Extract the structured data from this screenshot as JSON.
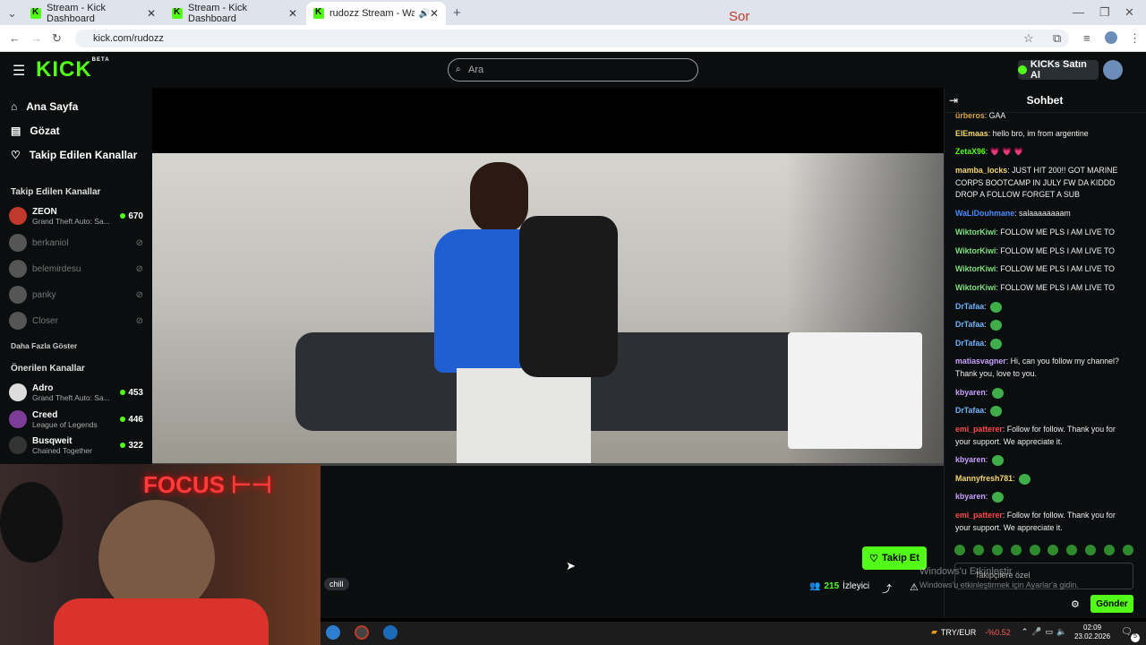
{
  "browser": {
    "tabs": [
      {
        "title": "Stream - Kick Dashboard"
      },
      {
        "title": "Stream - Kick Dashboard"
      },
      {
        "title": "rudozz Stream - Watch Live"
      }
    ],
    "url": "kick.com/rudozz",
    "overlay_text": "Sor"
  },
  "header": {
    "logo": "KICK",
    "logo_badge": "BETA",
    "search_placeholder": "Ara",
    "kicks_button": "KICKs Satın Al"
  },
  "sidebar": {
    "nav": [
      {
        "label": "Ana Sayfa",
        "icon": "home-icon"
      },
      {
        "label": "Gözat",
        "icon": "browse-icon"
      },
      {
        "label": "Takip Edilen Kanallar",
        "icon": "heart-icon"
      }
    ],
    "followed_title": "Takip Edilen Kanallar",
    "followed": [
      {
        "name": "ZEON",
        "game": "Grand Theft Auto: Sa...",
        "viewers": "670",
        "live": true
      },
      {
        "name": "berkaniol",
        "live": false
      },
      {
        "name": "belemirdesu",
        "live": false
      },
      {
        "name": "panky",
        "live": false
      },
      {
        "name": "Closer",
        "live": false
      }
    ],
    "show_more": "Daha Fazla Göster",
    "recommended_title": "Önerilen Kanallar",
    "recommended": [
      {
        "name": "Adro",
        "game": "Grand Theft Auto: Sa...",
        "viewers": "453"
      },
      {
        "name": "Creed",
        "game": "League of Legends",
        "viewers": "446"
      },
      {
        "name": "Busqweit",
        "game": "Chained Together",
        "viewers": "322"
      }
    ]
  },
  "player": {
    "follow_button": "Takip Et",
    "tag": "chill",
    "viewer_count": "215",
    "viewer_label": "İzleyici"
  },
  "chat": {
    "title": "Sohbet",
    "messages": [
      {
        "user": "ürberos",
        "color": "#d7a64a",
        "text": "GAA"
      },
      {
        "user": "ElEmaas",
        "color": "#f5d76e",
        "text": "hello bro, im from argentine"
      },
      {
        "user": "ZetaX96",
        "color": "#53fc18",
        "text": "💗 💗 💗"
      },
      {
        "user": "mamba_locks",
        "color": "#f5d76e",
        "text": "JUST HIT 200!! GOT MARINE CORPS BOOTCAMP IN JULY FW DA KIDDD DROP A FOLLOW FORGET A SUB"
      },
      {
        "user": "WaLiDouhmane",
        "color": "#4a8cff",
        "text": "salaaaaaaaam"
      },
      {
        "user": "WiktorKiwi",
        "color": "#7ee07e",
        "text": "FOLLOW ME PLS I AM LIVE TO"
      },
      {
        "user": "WiktorKiwi",
        "color": "#7ee07e",
        "text": "FOLLOW ME PLS I AM LIVE TO"
      },
      {
        "user": "WiktorKiwi",
        "color": "#7ee07e",
        "text": "FOLLOW ME PLS I AM LIVE TO"
      },
      {
        "user": "WiktorKiwi",
        "color": "#7ee07e",
        "text": "FOLLOW ME PLS I AM LIVE TO"
      },
      {
        "user": "DrTafaa",
        "color": "#6fb3ff",
        "text": ""
      },
      {
        "user": "DrTafaa",
        "color": "#6fb3ff",
        "text": ""
      },
      {
        "user": "DrTafaa",
        "color": "#6fb3ff",
        "text": ""
      },
      {
        "user": "matiasvagner",
        "color": "#c8a0ff",
        "text": "Hi, can you follow my channel? Thank you, love to you."
      },
      {
        "user": "kbyaren",
        "color": "#c8a0ff",
        "text": ""
      },
      {
        "user": "DrTafaa",
        "color": "#6fb3ff",
        "text": ""
      },
      {
        "user": "emi_patterer",
        "color": "#ff4a4a",
        "text": "Follow for follow. Thank you for your support. We appreciate it."
      },
      {
        "user": "kbyaren",
        "color": "#c8a0ff",
        "text": ""
      },
      {
        "user": "Mannyfresh781",
        "color": "#f5d76e",
        "text": ""
      },
      {
        "user": "kbyaren",
        "color": "#c8a0ff",
        "text": ""
      },
      {
        "user": "emi_patterer",
        "color": "#ff4a4a",
        "text": "Follow for follow. Thank you for your support. We appreciate it."
      }
    ],
    "input_placeholder": "Takipçilere özel",
    "send_button": "Gönder"
  },
  "windows": {
    "activation_title": "Windows'u Etkinleştir",
    "activation_sub": "Windows'u etkinleştirmek için Ayarlar'a gidin.",
    "currency": "TRY/EUR",
    "currency_change": "-%0.52",
    "time": "02:09",
    "date": "23.02.2026",
    "notif_count": "5"
  },
  "colors": {
    "accent": "#53fc18",
    "bg": "#0b0e0f"
  }
}
